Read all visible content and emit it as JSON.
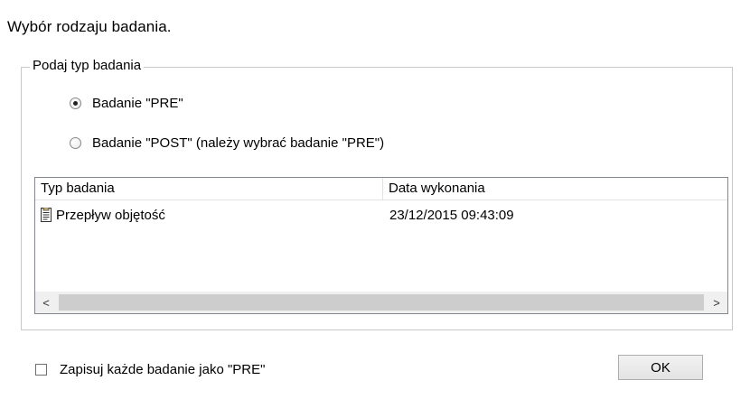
{
  "dialog": {
    "title": "Wybór rodzaju badania."
  },
  "group": {
    "legend": "Podaj typ badania",
    "radios": [
      {
        "label": "Badanie \"PRE\"",
        "checked": true
      },
      {
        "label": "Badanie \"POST\" (należy wybrać badanie \"PRE\")",
        "checked": false
      }
    ]
  },
  "list": {
    "columns": [
      "Typ badania",
      "Data wykonania"
    ],
    "rows": [
      {
        "icon": "document-icon",
        "type": "Przepływ objętość",
        "date": "23/12/2015 09:43:09"
      }
    ],
    "scroll_left": "<",
    "scroll_right": ">"
  },
  "footer": {
    "checkbox_label": "Zapisuj każde badanie jako \"PRE\"",
    "checkbox_checked": false,
    "ok_label": "OK"
  }
}
